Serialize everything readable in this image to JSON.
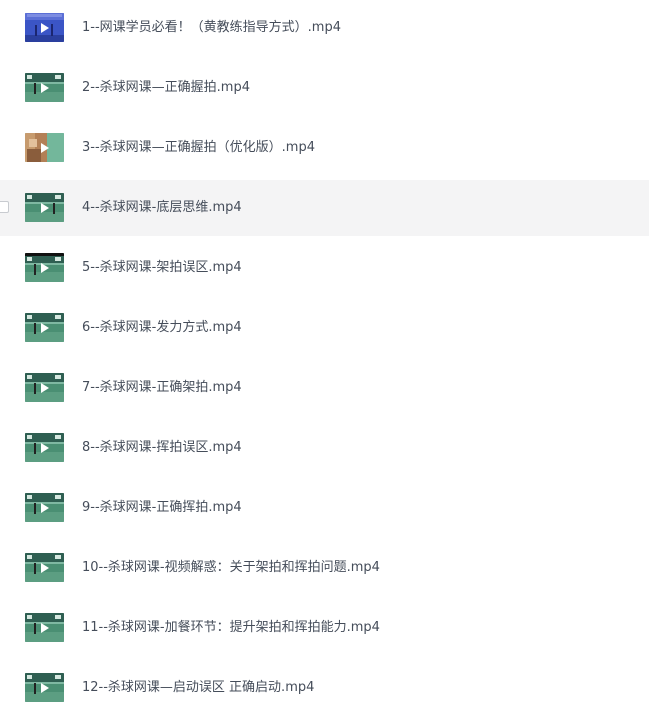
{
  "files": [
    {
      "name": "1--网课学员必看！（黄教练指导方式）.mp4",
      "thumbnail": "blue-video-thumbnail-icon",
      "hovered": false
    },
    {
      "name": "2--杀球网课—正确握拍.mp4",
      "thumbnail": "court-video-thumbnail-icon",
      "hovered": false
    },
    {
      "name": "3--杀球网课—正确握拍（优化版）.mp4",
      "thumbnail": "closeup-video-thumbnail-icon",
      "hovered": false
    },
    {
      "name": "4--杀球网课-底层思维.mp4",
      "thumbnail": "court-video-thumbnail-icon",
      "hovered": true
    },
    {
      "name": "5--杀球网课-架拍误区.mp4",
      "thumbnail": "court-video-thumbnail-icon",
      "hovered": false
    },
    {
      "name": "6--杀球网课-发力方式.mp4",
      "thumbnail": "court-video-thumbnail-icon",
      "hovered": false
    },
    {
      "name": "7--杀球网课-正确架拍.mp4",
      "thumbnail": "court-video-thumbnail-icon",
      "hovered": false
    },
    {
      "name": "8--杀球网课-挥拍误区.mp4",
      "thumbnail": "court-video-thumbnail-icon",
      "hovered": false
    },
    {
      "name": "9--杀球网课-正确挥拍.mp4",
      "thumbnail": "court-video-thumbnail-icon",
      "hovered": false
    },
    {
      "name": "10--杀球网课-视频解惑：关于架拍和挥拍问题.mp4",
      "thumbnail": "court-video-thumbnail-icon",
      "hovered": false
    },
    {
      "name": "11--杀球网课-加餐环节：提升架拍和挥拍能力.mp4",
      "thumbnail": "court-video-thumbnail-icon",
      "hovered": false
    },
    {
      "name": "12--杀球网课—启动误区 正确启动.mp4",
      "thumbnail": "court-video-thumbnail-icon",
      "hovered": false
    }
  ],
  "colors": {
    "text": "#454d5a",
    "hover_row": "#f4f4f5",
    "court_green": "#3f8a6e",
    "thumb_blue": "#3d57c7"
  }
}
